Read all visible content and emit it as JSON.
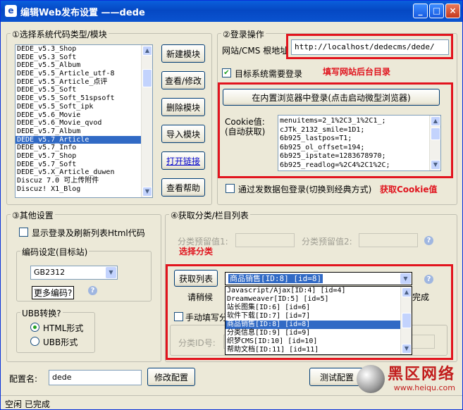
{
  "window": {
    "title": "编辑Web发布设置 ——dede",
    "min": "_",
    "max": "□",
    "close": "×"
  },
  "sec1": {
    "label": "①选择系统代码类型/模块",
    "list": [
      "DEDE_v5.3_Shop",
      "DEDE_v5.3_Soft",
      "DEDE_v5.5_Album",
      "DEDE_v5.5_Article_utf-8",
      "DEDE_v5.5_Article_点评",
      "DEDE_v5.5_Soft",
      "DEDE_v5.5_Soft_51spsoft",
      "DEDE_v5.5_Soft_ipk",
      "DEDE_v5.6_Movie",
      "DEDE_v5.6_Movie_qvod",
      "DEDE_v5.7_Album",
      "DEDE_v5.7_Article",
      "DEDE_v5.7_Info",
      "DEDE_v5.7_Shop",
      "DEDE_v5.7_Soft",
      "DEDE_v5.X_Article_duwen",
      "Discuz 7.0 可上传附件",
      "Discuz! X1_Blog"
    ],
    "selected_index": 11,
    "btn_new": "新建模块",
    "btn_view": "查看/修改",
    "btn_delete": "删除模块",
    "btn_import": "导入模块",
    "btn_open": "打开链接",
    "btn_help": "查看帮助"
  },
  "sec2": {
    "label": "②登录操作",
    "url_label": "网站/CMS 根地址",
    "url_value": "http://localhost/dedecms/dede/",
    "need_login": "目标系统需要登录",
    "annot_url": "填写网站后台目录",
    "login_button": "在内置浏览器中登录(点击启动微型浏览器)",
    "cookie_label1": "Cookie值:",
    "cookie_label2": "(自动获取)",
    "cookie_lines": [
      "menuitems=2_1%2C3_1%2C1_;",
      "cJTk_2132_smile=1D1;",
      "6b925_lastpos=T1;",
      "6b925_ol_offset=194;",
      "6b925_ipstate=1283678970;",
      "6b925_readlog=%2C4%2C1%2C;"
    ],
    "packet_login": "通过发数据包登录(切换到经典方式)",
    "annot_cookie": "获取Cookie值"
  },
  "sec3": {
    "label": "③其他设置",
    "show_html": "显示登录及刷新列表Html代码",
    "encoding_label": "编码设定(目标站)",
    "encoding_value": "GB2312",
    "more_encoding": "更多编码?",
    "ubb_label": "UBB转换?",
    "html_mode": "HTML形式",
    "ubb_mode": "UBB形式"
  },
  "sec4": {
    "label": "④获取分类/栏目列表",
    "preset1": "分类预留值1:",
    "preset2": "分类预留值2:",
    "annot_cat": "选择分类",
    "fetch_btn": "获取列表",
    "selected_cat": "商品销售[ID:8]   [id=8]",
    "wait": "请稍候",
    "done": "完成",
    "manual": "手动填写分",
    "cat_id_label": "分类ID号:",
    "options": [
      "Javascript/Ajax[ID:4]   [id=4]",
      "Dreamweaver[ID:5]   [id=5]",
      "站长图集[ID:6]   [id=6]",
      "软件下载[ID:7]   [id=7]",
      "商品销售[ID:8]   [id=8]",
      "分类信息[ID:9]   [id=9]",
      "织梦CMS[ID:10]   [id=10]",
      "帮助文档[ID:11]   [id=11]"
    ],
    "options_selected": 4
  },
  "footer": {
    "config_label": "配置名:",
    "config_value": "dede",
    "modify_btn": "修改配置",
    "test_btn": "测试配置"
  },
  "status": {
    "text": "空闲 已完成"
  },
  "watermark": {
    "brand": "黑区网络",
    "url": "www.heiqu.com"
  },
  "colors": {
    "annotation": "#e0141e",
    "selection": "#316ac5",
    "titlebar": "#0548c3"
  }
}
